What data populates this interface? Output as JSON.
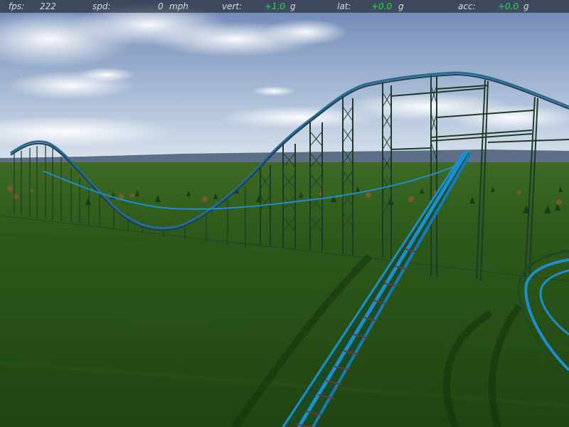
{
  "hud": {
    "fps": {
      "label": "fps:",
      "value": "222"
    },
    "spd": {
      "label": "spd:",
      "value": "0",
      "unit": "mph"
    },
    "vert": {
      "label": "vert:",
      "value": "+1.0",
      "unit": "g"
    },
    "lat": {
      "label": "lat:",
      "value": "+0.0",
      "unit": "g"
    },
    "acc": {
      "label": "acc:",
      "value": "+0.0",
      "unit": "g"
    }
  },
  "colors": {
    "sky_top": "#6f88b6",
    "sky_horizon": "#d9e3ee",
    "grass_near": "#1f4a12",
    "grass_far": "#3f6d23",
    "track_rail": "#1c8fcf",
    "support": "#1d3a2b",
    "hud_value": "#22e03a",
    "hud_text": "#dcdcdc"
  },
  "icons": [
    "roller-coaster-track",
    "support-tower",
    "tree"
  ]
}
